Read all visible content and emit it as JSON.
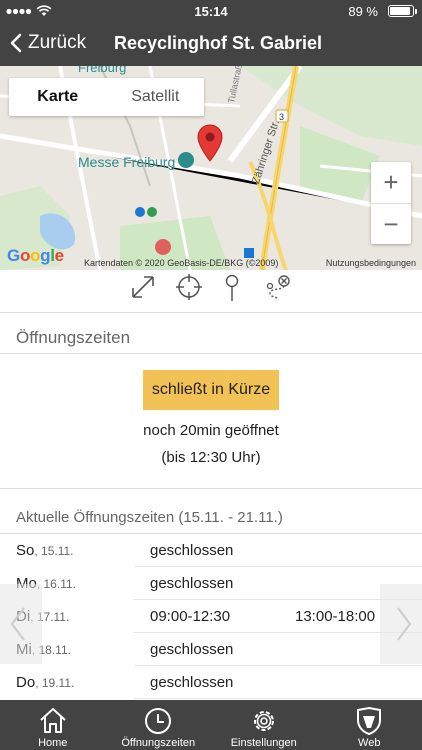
{
  "status_bar": {
    "time": "15:14",
    "battery": "89 %",
    "battery_level": 0.89
  },
  "nav": {
    "back_label": "Zurück",
    "title": "Recyclinghof St. Gabriel"
  },
  "map": {
    "tabs": [
      {
        "label": "Karte",
        "selected": true
      },
      {
        "label": "Satellit",
        "selected": false
      }
    ],
    "labels": {
      "city": "Freiburg",
      "poi": "Messe Freiburg",
      "street": "Zähringer Str.",
      "street_small": "Tullastraße",
      "road_number": "3"
    },
    "zoom_in": "+",
    "zoom_out": "−",
    "logo": "Google",
    "attribution": "Kartendaten © 2020 GeoBasis-DE/BKG (©2009)",
    "terms": "Nutzungsbedingungen",
    "colors": {
      "pin": "#e53935",
      "road": "#f7d66b",
      "park": "#cfe8c3",
      "water": "#a8cdee",
      "label": "#2a8d8b"
    }
  },
  "tools": [
    "expand-icon",
    "target-icon",
    "pin-icon",
    "route-icon"
  ],
  "opening": {
    "header": "Öffnungszeiten",
    "status_label": "schließt in Kürze",
    "status_color": "#f3c257",
    "remaining": "noch 20min geöffnet",
    "until": "(bis 12:30 Uhr)"
  },
  "current": {
    "header": "Aktuelle Öffnungszeiten (15.11. - 21.11.)",
    "rows": [
      {
        "day": "So",
        "date": ", 15.11.",
        "t1": "geschlossen",
        "t2": ""
      },
      {
        "day": "Mo",
        "date": ", 16.11.",
        "t1": "geschlossen",
        "t2": ""
      },
      {
        "day": "Di",
        "date": ", 17.11.",
        "t1": "09:00-12:30",
        "t2": "13:00-18:00"
      },
      {
        "day": "Mi",
        "date": ", 18.11.",
        "t1": "geschlossen",
        "t2": ""
      },
      {
        "day": "Do",
        "date": ", 19.11.",
        "t1": "geschlossen",
        "t2": ""
      }
    ]
  },
  "tabbar": {
    "items": [
      {
        "label": "Home",
        "icon": "home-icon"
      },
      {
        "label": "Öffnungszeiten",
        "icon": "clock-icon"
      },
      {
        "label": "Einstellungen",
        "icon": "gear-icon"
      },
      {
        "label": "Web",
        "icon": "shield-icon"
      }
    ]
  }
}
